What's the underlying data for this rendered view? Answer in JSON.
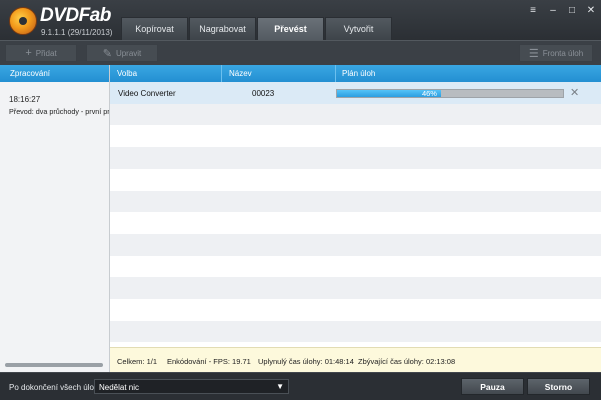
{
  "app": {
    "brand": "DVDFab",
    "version": "9.1.1.1 (29/11/2013)",
    "tabs": [
      {
        "label": "Kopírovat",
        "active": false
      },
      {
        "label": "Nagrabovat",
        "active": false
      },
      {
        "label": "Převést",
        "active": true
      },
      {
        "label": "Vytvořit",
        "active": false
      }
    ],
    "window_controls": {
      "menu": "≡",
      "minimize": "–",
      "maximize": "□",
      "close": "✕"
    }
  },
  "toolbar": {
    "add_label": "Přidat",
    "edit_label": "Upravit",
    "queue_label": "Fronta úloh"
  },
  "left_panel": {
    "header": "Zpracování",
    "time": "18:16:27",
    "description": "Převod: dva průchody - první průc"
  },
  "table": {
    "columns": [
      "Volba",
      "Název",
      "Plán úloh"
    ],
    "rows": [
      {
        "option": "Video Converter",
        "name": "00023",
        "progress_percent": 46,
        "progress_label": "46%"
      }
    ]
  },
  "status": {
    "total": "Celkem: 1/1",
    "fps": "Enkódování - FPS: 19.71",
    "elapsed": "Uplynulý čas úlohy: 01:48:14",
    "remaining": "Zbývající čas úlohy: 02:13:08"
  },
  "bottom": {
    "after_label": "Po dokončení všech úloh:",
    "after_value": "Nedělat nic",
    "pause_label": "Pauza",
    "stop_label": "Storno"
  },
  "colors": {
    "accent_blue": "#2c9ee0",
    "header_blue": "#238fd2",
    "status_bg": "#fdf9dc"
  }
}
